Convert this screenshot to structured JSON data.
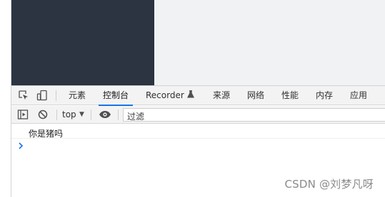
{
  "devtools": {
    "tabs": [
      {
        "label": "元素"
      },
      {
        "label": "控制台"
      },
      {
        "label": "Recorder"
      },
      {
        "label": "来源"
      },
      {
        "label": "网络"
      },
      {
        "label": "性能"
      },
      {
        "label": "内存"
      },
      {
        "label": "应用"
      }
    ],
    "active_tab": "控制台",
    "accent_color": "#1a73e8"
  },
  "console_toolbar": {
    "context_label": "top",
    "filter_placeholder": "过滤"
  },
  "console": {
    "messages": [
      "你是猪吗"
    ]
  },
  "watermark": "CSDN @刘梦凡呀",
  "colors": {
    "dark_panel": "#2b3440",
    "viewport_bg": "#f1f2f4",
    "toolbar_bg": "#f3f3f3",
    "prompt_chevron": "#1a73e8"
  }
}
